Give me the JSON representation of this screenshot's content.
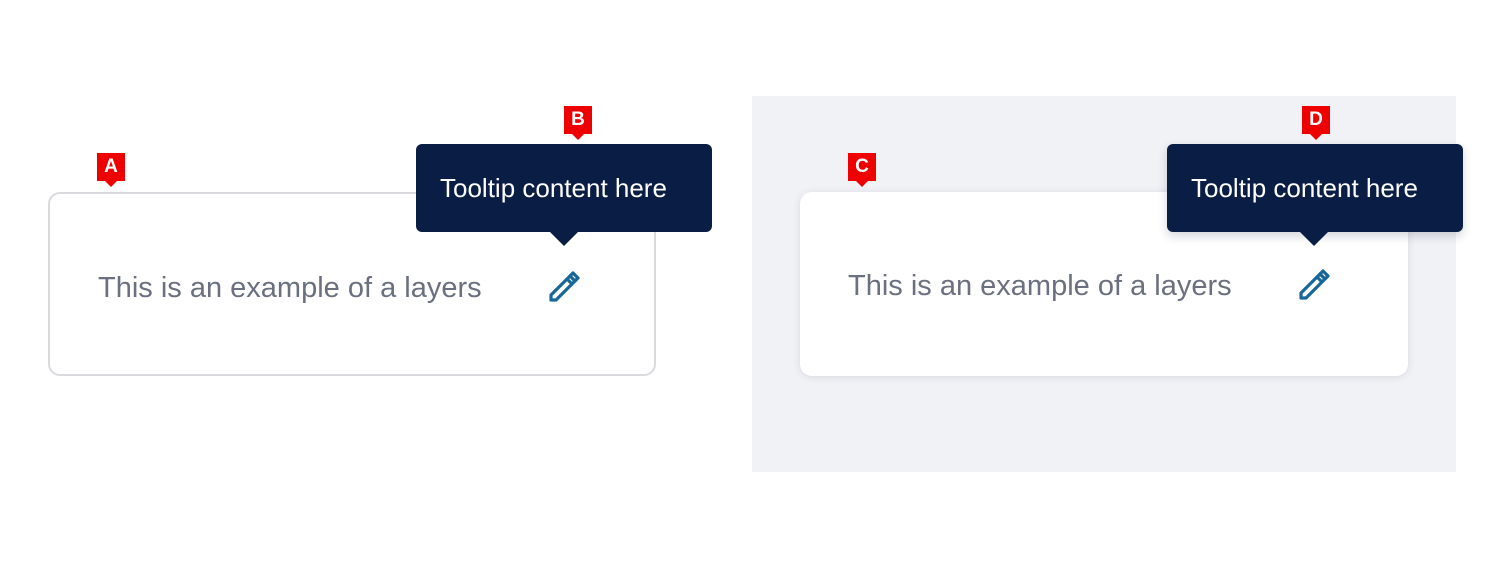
{
  "markers": [
    "A",
    "B",
    "C",
    "D"
  ],
  "card_outline": {
    "text": "This is an example of a layers",
    "tooltip": "Tooltip content here",
    "icon": "pencil-icon"
  },
  "card_elevated": {
    "text": "This is an example of a layers",
    "tooltip": "Tooltip content here",
    "icon": "pencil-icon"
  },
  "colors": {
    "tooltip_bg": "#0a1d44",
    "icon": "#17679a",
    "text": "#6b7080",
    "panel_bg": "#f1f2f6",
    "marker": "#ee0000"
  }
}
